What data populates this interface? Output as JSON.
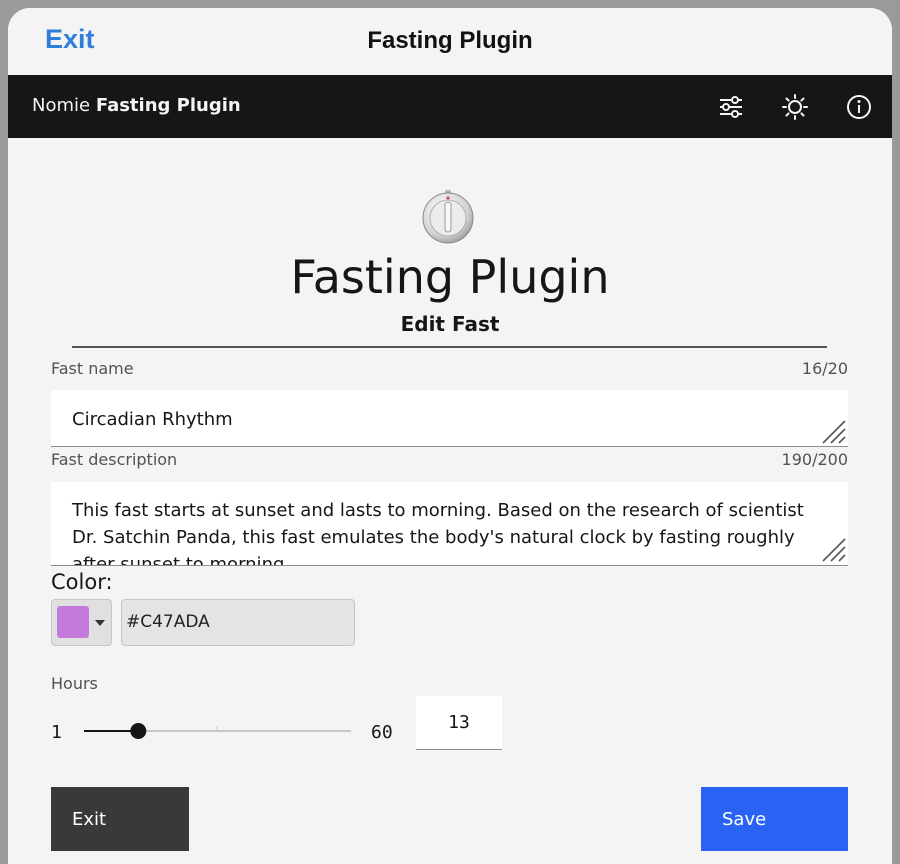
{
  "modal": {
    "exit_label": "Exit",
    "title": "Fasting Plugin"
  },
  "app_bar": {
    "brand_prefix": "Nomie",
    "brand_name": "Fasting Plugin",
    "icons": [
      "settings-sliders-icon",
      "brightness-icon",
      "info-icon"
    ]
  },
  "header": {
    "logo_icon": "stopwatch-icon",
    "title": "Fasting Plugin",
    "subtitle": "Edit Fast"
  },
  "form": {
    "name": {
      "label": "Fast name",
      "count": "16/20",
      "value": "Circadian Rhythm"
    },
    "description": {
      "label": "Fast description",
      "count": "190/200",
      "value": "This fast starts at sunset and lasts to morning. Based on the research of scientist Dr. Satchin Panda, this fast emulates the body's natural clock by fasting roughly after sunset to morning."
    },
    "color": {
      "label": "Color:",
      "value": "#C47ADA"
    },
    "hours": {
      "label": "Hours",
      "min": "1",
      "max": "60",
      "value": "13"
    }
  },
  "buttons": {
    "exit": "Exit",
    "save": "Save"
  },
  "colors": {
    "accent_link": "#2f7ed8",
    "primary_button": "#2a63f4",
    "secondary_button": "#393939",
    "app_bar": "#161616"
  }
}
